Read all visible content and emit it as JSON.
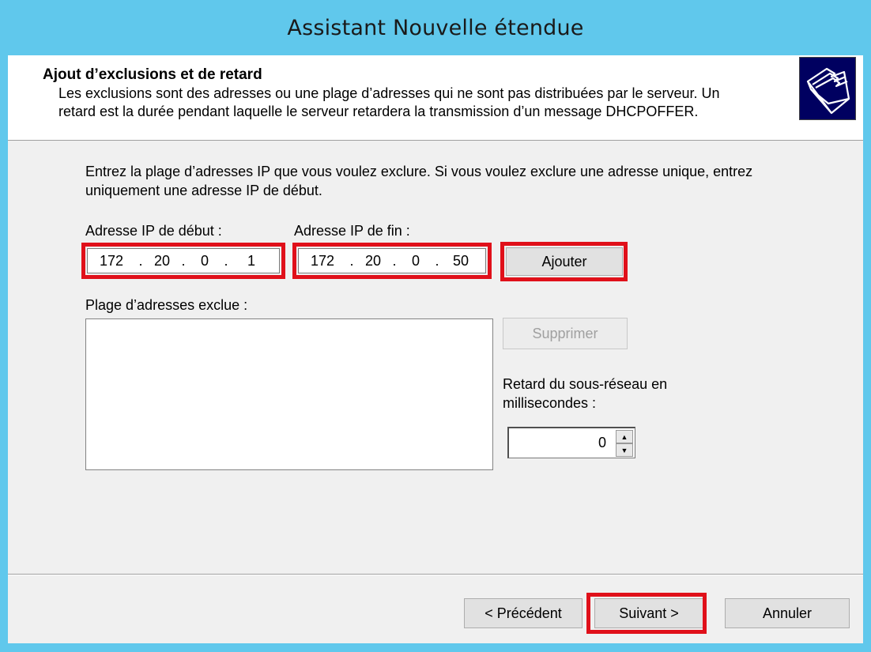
{
  "window": {
    "title": "Assistant Nouvelle étendue"
  },
  "header": {
    "title": "Ajout d’exclusions et de retard",
    "description": "Les exclusions sont des adresses ou une plage d’adresses qui ne sont pas distribuées par le serveur. Un retard est la durée pendant laquelle le serveur retardera la transmission d’un message DHCPOFFER.",
    "icon": "folders-icon"
  },
  "body": {
    "instruction": "Entrez la plage d’adresses IP que vous voulez exclure. Si vous voulez exclure une adresse unique, entrez uniquement une adresse IP de début.",
    "start_ip": {
      "label": "Adresse IP de début :",
      "octets": [
        "172",
        "20",
        "0",
        "1"
      ]
    },
    "end_ip": {
      "label": "Adresse IP de fin :",
      "octets": [
        "172",
        "20",
        "0",
        "50"
      ]
    },
    "add_button": "Ajouter",
    "excluded_label": "Plage d’adresses exclue :",
    "excluded_items": [],
    "remove_button": "Supprimer",
    "delay_label": "Retard du sous-réseau en millisecondes :",
    "delay_value": "0"
  },
  "footer": {
    "back_button": "< Précédent",
    "next_button": "Suivant >",
    "cancel_button": "Annuler"
  },
  "colors": {
    "highlight": "#e0101a",
    "titlebar": "#60c8ec"
  }
}
